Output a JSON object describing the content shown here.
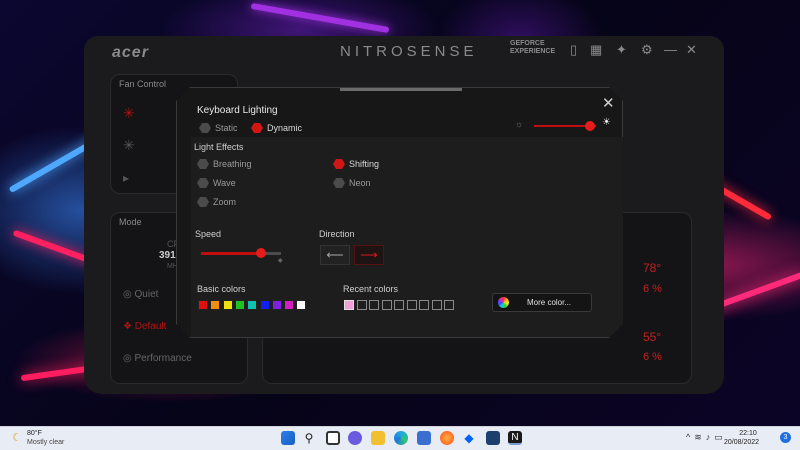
{
  "nitrosense": {
    "logo": "acer",
    "title": "NITROSENSE",
    "geforce_line1": "GEFORCE",
    "geforce_line2": "EXPERIENCE",
    "fan_control_label": "Fan Control",
    "mode_label": "Mode",
    "cpu_label": "CPU",
    "cpu_value": "3915",
    "cpu_unit": "MHz",
    "modes": [
      "Quiet",
      "Default",
      "Performance"
    ],
    "temp_1": "78°",
    "usage_1": "6 %",
    "temp_2": "55°",
    "usage_2": "6 %"
  },
  "dialog": {
    "title": "Keyboard  Lighting",
    "close": "✕",
    "lighting_modes": [
      {
        "label": "Static",
        "selected": false
      },
      {
        "label": "Dynamic",
        "selected": true
      }
    ],
    "brightness_level": 0.9,
    "light_effects_label": "Light Effects",
    "effects": [
      {
        "label": "Breathing",
        "selected": false
      },
      {
        "label": "Shifting",
        "selected": true
      },
      {
        "label": "Wave",
        "selected": false
      },
      {
        "label": "Neon",
        "selected": false
      },
      {
        "label": "Zoom",
        "selected": false
      }
    ],
    "speed_label": "Speed",
    "speed_level": 0.75,
    "direction_label": "Direction",
    "direction_left": "⟵",
    "direction_right": "⟶",
    "basic_colors_label": "Basic colors",
    "basic_colors": [
      "#e01010",
      "#f08c10",
      "#f0e010",
      "#20c020",
      "#10c0b0",
      "#1020f0",
      "#8020e0",
      "#d020c0",
      "#ffffff"
    ],
    "recent_colors_label": "Recent colors",
    "recent_colors": [
      "#f0a0d8",
      "",
      "",
      "",
      "",
      "",
      "",
      "",
      ""
    ],
    "more_color_label": "More color..."
  },
  "taskbar": {
    "weather_temp": "80°F",
    "weather_desc": "Mostly clear",
    "time": "22:10",
    "date": "20/08/2022",
    "notification_count": "3"
  },
  "colors": {
    "accent_red": "#d11616",
    "dialog_bg": "#171717"
  }
}
